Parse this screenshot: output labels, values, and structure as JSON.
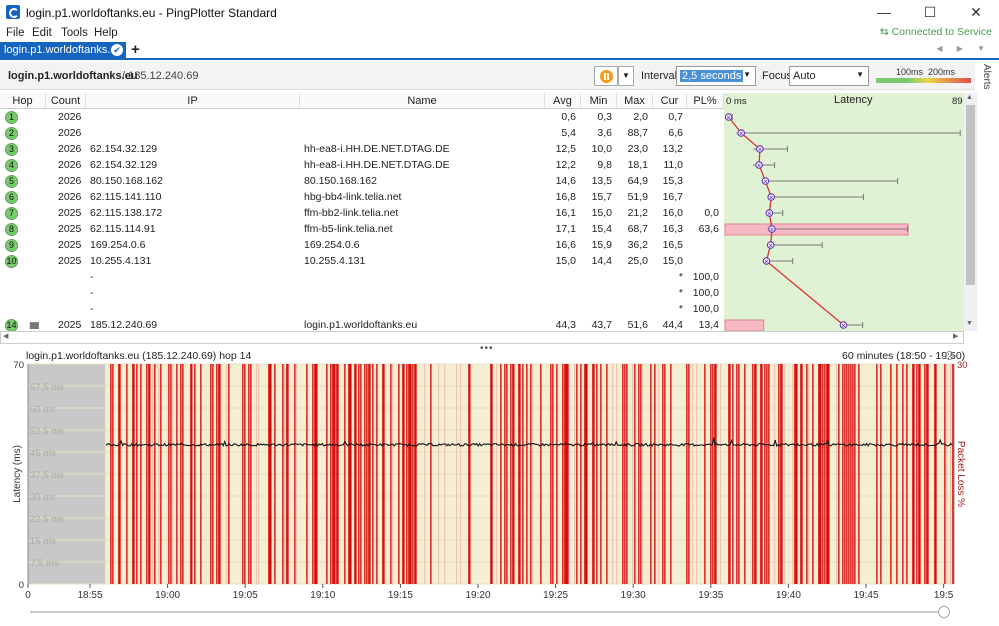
{
  "window": {
    "title": "login.p1.worldoftanks.eu - PingPlotter Standard",
    "min_glyph": "—",
    "max_glyph": "☐",
    "close_glyph": "✕",
    "app_icon": "pingplotter-logo-icon"
  },
  "menu": {
    "items": [
      "File",
      "Edit",
      "Tools",
      "Help"
    ],
    "status": "Connected to Service",
    "status_color": "#4a9a4a"
  },
  "tabs": {
    "active": "login.p1.worldoftanks.eu",
    "add_glyph": "+",
    "nav_glyph": "◀ ▶ ▼"
  },
  "toolbar": {
    "host": "login.p1.worldoftanks.eu",
    "ip_text": "/ 185.12.240.69",
    "interval_label": "Interval",
    "interval_value": "2,5 seconds",
    "focus_label": "Focus",
    "focus_value": "Auto",
    "legend_100": "100ms",
    "legend_200": "200ms",
    "alerts_label": "Alerts"
  },
  "table": {
    "headers": {
      "hop": "Hop",
      "count": "Count",
      "ip": "IP",
      "name": "Name",
      "avg": "Avg",
      "min": "Min",
      "max": "Max",
      "cur": "Cur",
      "pl": "PL%",
      "latency_min": "0 ms",
      "latency": "Latency",
      "latency_max": "89"
    },
    "rows": [
      {
        "hop": "1",
        "count": "2026",
        "ip": "",
        "name": "",
        "avg": "0,6",
        "min": "0,3",
        "max": "2,0",
        "cur": "0,7",
        "pl": ""
      },
      {
        "hop": "2",
        "count": "2026",
        "ip": "",
        "name": "",
        "avg": "5,4",
        "min": "3,6",
        "max": "88,7",
        "cur": "6,6",
        "pl": ""
      },
      {
        "hop": "3",
        "count": "2026",
        "ip": "62.154.32.129",
        "name": "hh-ea8-i.HH.DE.NET.DTAG.DE",
        "avg": "12,5",
        "min": "10,0",
        "max": "23,0",
        "cur": "13,2",
        "pl": ""
      },
      {
        "hop": "4",
        "count": "2026",
        "ip": "62.154.32.129",
        "name": "hh-ea8-i.HH.DE.NET.DTAG.DE",
        "avg": "12,2",
        "min": "9,8",
        "max": "18,1",
        "cur": "11,0",
        "pl": ""
      },
      {
        "hop": "5",
        "count": "2026",
        "ip": "80.150.168.162",
        "name": "80.150.168.162",
        "avg": "14,6",
        "min": "13,5",
        "max": "64,9",
        "cur": "15,3",
        "pl": ""
      },
      {
        "hop": "6",
        "count": "2026",
        "ip": "62.115.141.110",
        "name": "hbg-bb4-link.telia.net",
        "avg": "16,8",
        "min": "15,7",
        "max": "51,9",
        "cur": "16,7",
        "pl": ""
      },
      {
        "hop": "7",
        "count": "2025",
        "ip": "62.115.138.172",
        "name": "ffm-bb2-link.telia.net",
        "avg": "16,1",
        "min": "15,0",
        "max": "21,2",
        "cur": "16,0",
        "pl": "0,0"
      },
      {
        "hop": "8",
        "count": "2025",
        "ip": "62.115.114.91",
        "name": "ffm-b5-link.telia.net",
        "avg": "17,1",
        "min": "15,4",
        "max": "68,7",
        "cur": "16,3",
        "pl": "63,6"
      },
      {
        "hop": "9",
        "count": "2025",
        "ip": "169.254.0.6",
        "name": "169.254.0.6",
        "avg": "16,6",
        "min": "15,9",
        "max": "36,2",
        "cur": "16,5",
        "pl": ""
      },
      {
        "hop": "10",
        "count": "2025",
        "ip": "10.255.4.131",
        "name": "10.255.4.131",
        "avg": "15,0",
        "min": "14,4",
        "max": "25,0",
        "cur": "15,0",
        "pl": ""
      },
      {
        "hop": "",
        "count": "",
        "ip": "-",
        "name": "",
        "avg": "",
        "min": "",
        "max": "",
        "cur": "*",
        "pl": "100,0"
      },
      {
        "hop": "",
        "count": "",
        "ip": "-",
        "name": "",
        "avg": "",
        "min": "",
        "max": "",
        "cur": "*",
        "pl": "100,0"
      },
      {
        "hop": "",
        "count": "",
        "ip": "-",
        "name": "",
        "avg": "",
        "min": "",
        "max": "",
        "cur": "*",
        "pl": "100,0"
      },
      {
        "hop": "14",
        "count": "2025",
        "ip": "185.12.240.69",
        "name": "login.p1.worldoftanks.eu",
        "avg": "44,3",
        "min": "43,7",
        "max": "51,6",
        "cur": "44,4",
        "pl": "13,4"
      }
    ]
  },
  "splitter_glyph": "•••",
  "graph": {
    "title": "login.p1.worldoftanks.eu (185.12.240.69) hop 14",
    "range": "60 minutes (18:50 - 19:50)",
    "range_caret": "⌄",
    "ylabel": "Latency (ms)",
    "y2label": "Packet Loss %",
    "y_ticks": [
      "70",
      "67,5 ms",
      "60 ms",
      "52,5 ms",
      "45 ms",
      "37,5 ms",
      "30 ms",
      "22,5 ms",
      "15 ms",
      "7,5 ms",
      "0"
    ],
    "y2_max": "30",
    "x_ticks": [
      "0",
      "18:55",
      "19:00",
      "19:05",
      "19:10",
      "19:15",
      "19:20",
      "19:25",
      "19:30",
      "19:35",
      "19:40",
      "19:45",
      "19:5"
    ],
    "colors": {
      "loss": "#d40000",
      "latency_bg": "#f4eed2",
      "no_data": "#c8c8c8",
      "line": "#111111"
    }
  },
  "chart_data": {
    "type": "line",
    "title": "login.p1.worldoftanks.eu (185.12.240.69) hop 14",
    "xlabel": "",
    "ylabel": "Latency (ms)",
    "y2label": "Packet Loss %",
    "ylim": [
      0,
      70
    ],
    "y2lim": [
      0,
      30
    ],
    "xlim": [
      "18:50",
      "19:50"
    ],
    "no_data_range": [
      "18:50",
      "18:55"
    ],
    "series": [
      {
        "values": [
          44.3
        ]
      }
    ]
  }
}
